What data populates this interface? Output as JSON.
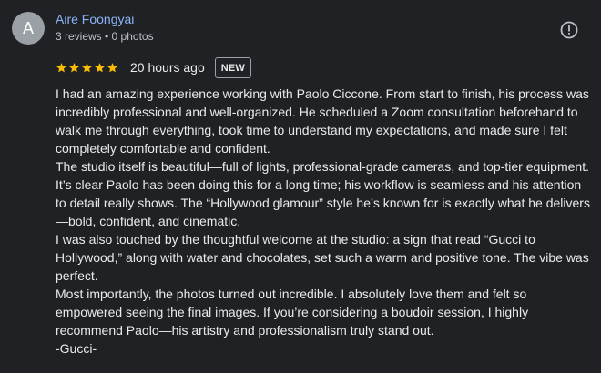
{
  "reviewer": {
    "initial": "A",
    "name": "Aire Foongyai",
    "meta": "3 reviews • 0 photos"
  },
  "rating": {
    "stars": 5,
    "max": 5,
    "color": "#fbbc04",
    "time": "20 hours ago",
    "badge": "NEW"
  },
  "icons": {
    "more": "exclamation-circle-icon",
    "star": "star-icon"
  },
  "review": {
    "paragraphs": [
      "I had an amazing experience working with Paolo Ciccone. From start to finish, his process was incredibly professional and well-organized. He scheduled a Zoom consultation beforehand to walk me through everything, took time to understand my expectations, and made sure I felt completely comfortable and confident.",
      "The studio itself is beautiful—full of lights, professional-grade cameras, and top-tier equipment. It’s clear Paolo has been doing this for a long time; his workflow is seamless and his attention to detail really shows. The “Hollywood glamour” style he’s known for is exactly what he delivers—bold, confident, and cinematic.",
      "I was also touched by the thoughtful welcome at the studio: a sign that read “Gucci to Hollywood,” along with water and chocolates, set such a warm and positive tone. The vibe was perfect.",
      "Most importantly, the photos turned out incredible. I absolutely love them and felt so empowered seeing the final images. If you’re considering a boudoir session, I highly recommend Paolo—his artistry and professionalism truly stand out.",
      "-Gucci-"
    ]
  }
}
